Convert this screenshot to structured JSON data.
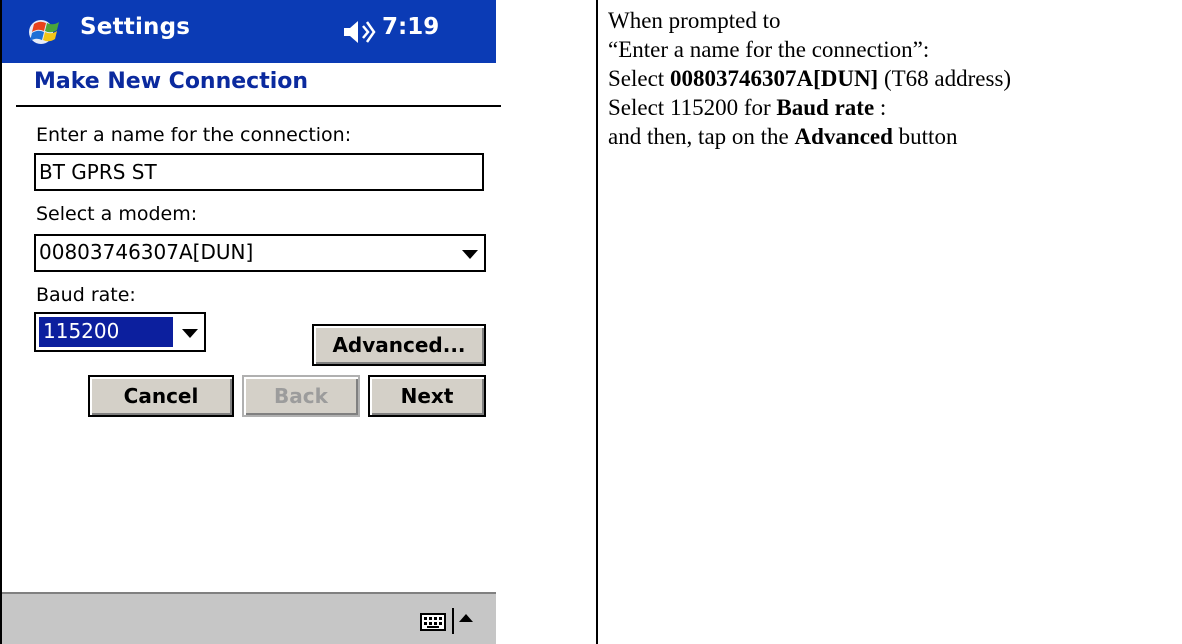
{
  "device": {
    "titlebar": {
      "app_title": "Settings",
      "clock": "7:19",
      "start_icon": "windows-flag-icon",
      "volume_icon": "speaker-icon"
    },
    "page_heading": "Make New Connection",
    "form": {
      "name_label": "Enter a name for the connection:",
      "name_value": "BT GPRS ST",
      "modem_label": "Select a modem:",
      "modem_value": "00803746307A[DUN]",
      "baud_label": "Baud rate:",
      "baud_value": "115200"
    },
    "buttons": {
      "advanced": "Advanced...",
      "cancel": "Cancel",
      "back": "Back",
      "next": "Next"
    },
    "bottombar": {
      "keyboard_icon": "keyboard-icon",
      "sip_arrow_icon": "up-arrow-icon"
    },
    "colors": {
      "titlebar": "#0b3bb5",
      "heading": "#0b2a9e",
      "selection": "#0c1f9e",
      "button_face": "#d4d0c8",
      "bottombar": "#c6c6c6"
    }
  },
  "instructions": {
    "line1": "When prompted to",
    "line2": "“Enter a name for the connection”:",
    "line3_prefix": "Select ",
    "line3_bold": "00803746307A[DUN]",
    "line3_suffix": " (T68 address)",
    "line4_prefix": "Select 115200 for ",
    "line4_bold": "Baud rate",
    "line4_suffix": " :",
    "line5_prefix": "and then, tap on the ",
    "line5_bold": "Advanced",
    "line5_suffix": " button"
  }
}
